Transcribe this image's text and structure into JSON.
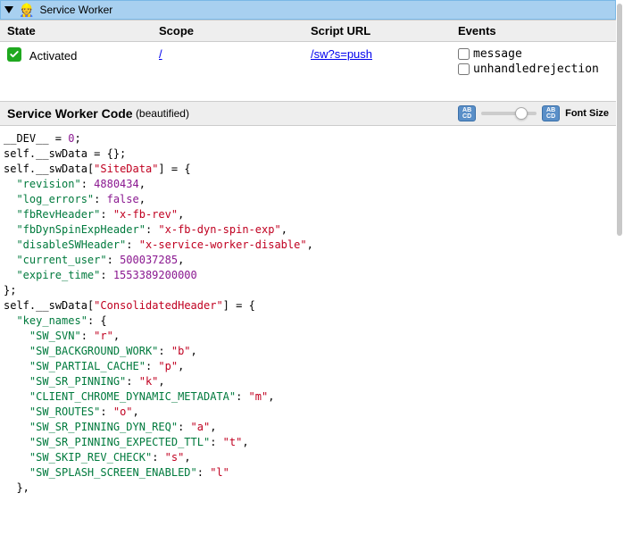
{
  "header": {
    "title": "Service Worker",
    "icon": "construction-worker"
  },
  "table": {
    "columns": [
      "State",
      "Scope",
      "Script URL",
      "Events"
    ],
    "state_label": "Activated",
    "scope_link": "/",
    "script_url_link": "/sw?s=push",
    "events": [
      {
        "name": "message",
        "checked": false
      },
      {
        "name": "unhandledrejection",
        "checked": false
      }
    ]
  },
  "codeHeader": {
    "title": "Service Worker Code",
    "sub": "(beautified)",
    "fontLabel": "Font Size"
  },
  "code": {
    "lines": [
      [
        [
          "ident",
          "__DEV__"
        ],
        [
          "punct",
          " = "
        ],
        [
          "num",
          "0"
        ],
        [
          "punct",
          ";"
        ]
      ],
      [
        [
          "ident",
          "self"
        ],
        [
          "punct",
          "."
        ],
        [
          "ident",
          "__swData"
        ],
        [
          "punct",
          " = {};"
        ]
      ],
      [
        [
          "ident",
          "self"
        ],
        [
          "punct",
          "."
        ],
        [
          "ident",
          "__swData"
        ],
        [
          "punct",
          "["
        ],
        [
          "str",
          "\"SiteData\""
        ],
        [
          "punct",
          "] = {"
        ]
      ],
      [
        [
          "pad",
          "  "
        ],
        [
          "prop",
          "\"revision\""
        ],
        [
          "punct",
          ": "
        ],
        [
          "num",
          "4880434"
        ],
        [
          "punct",
          ","
        ]
      ],
      [
        [
          "pad",
          "  "
        ],
        [
          "prop",
          "\"log_errors\""
        ],
        [
          "punct",
          ": "
        ],
        [
          "bool",
          "false"
        ],
        [
          "punct",
          ","
        ]
      ],
      [
        [
          "pad",
          "  "
        ],
        [
          "prop",
          "\"fbRevHeader\""
        ],
        [
          "punct",
          ": "
        ],
        [
          "str",
          "\"x-fb-rev\""
        ],
        [
          "punct",
          ","
        ]
      ],
      [
        [
          "pad",
          "  "
        ],
        [
          "prop",
          "\"fbDynSpinExpHeader\""
        ],
        [
          "punct",
          ": "
        ],
        [
          "str",
          "\"x-fb-dyn-spin-exp\""
        ],
        [
          "punct",
          ","
        ]
      ],
      [
        [
          "pad",
          "  "
        ],
        [
          "prop",
          "\"disableSWHeader\""
        ],
        [
          "punct",
          ": "
        ],
        [
          "str",
          "\"x-service-worker-disable\""
        ],
        [
          "punct",
          ","
        ]
      ],
      [
        [
          "pad",
          "  "
        ],
        [
          "prop",
          "\"current_user\""
        ],
        [
          "punct",
          ": "
        ],
        [
          "num",
          "500037285"
        ],
        [
          "punct",
          ","
        ]
      ],
      [
        [
          "pad",
          "  "
        ],
        [
          "prop",
          "\"expire_time\""
        ],
        [
          "punct",
          ": "
        ],
        [
          "num",
          "1553389200000"
        ]
      ],
      [
        [
          "punct",
          "};"
        ]
      ],
      [
        [
          "ident",
          "self"
        ],
        [
          "punct",
          "."
        ],
        [
          "ident",
          "__swData"
        ],
        [
          "punct",
          "["
        ],
        [
          "str",
          "\"ConsolidatedHeader\""
        ],
        [
          "punct",
          "] = {"
        ]
      ],
      [
        [
          "pad",
          "  "
        ],
        [
          "prop",
          "\"key_names\""
        ],
        [
          "punct",
          ": {"
        ]
      ],
      [
        [
          "pad",
          "    "
        ],
        [
          "prop",
          "\"SW_SVN\""
        ],
        [
          "punct",
          ": "
        ],
        [
          "str",
          "\"r\""
        ],
        [
          "punct",
          ","
        ]
      ],
      [
        [
          "pad",
          "    "
        ],
        [
          "prop",
          "\"SW_BACKGROUND_WORK\""
        ],
        [
          "punct",
          ": "
        ],
        [
          "str",
          "\"b\""
        ],
        [
          "punct",
          ","
        ]
      ],
      [
        [
          "pad",
          "    "
        ],
        [
          "prop",
          "\"SW_PARTIAL_CACHE\""
        ],
        [
          "punct",
          ": "
        ],
        [
          "str",
          "\"p\""
        ],
        [
          "punct",
          ","
        ]
      ],
      [
        [
          "pad",
          "    "
        ],
        [
          "prop",
          "\"SW_SR_PINNING\""
        ],
        [
          "punct",
          ": "
        ],
        [
          "str",
          "\"k\""
        ],
        [
          "punct",
          ","
        ]
      ],
      [
        [
          "pad",
          "    "
        ],
        [
          "prop",
          "\"CLIENT_CHROME_DYNAMIC_METADATA\""
        ],
        [
          "punct",
          ": "
        ],
        [
          "str",
          "\"m\""
        ],
        [
          "punct",
          ","
        ]
      ],
      [
        [
          "pad",
          "    "
        ],
        [
          "prop",
          "\"SW_ROUTES\""
        ],
        [
          "punct",
          ": "
        ],
        [
          "str",
          "\"o\""
        ],
        [
          "punct",
          ","
        ]
      ],
      [
        [
          "pad",
          "    "
        ],
        [
          "prop",
          "\"SW_SR_PINNING_DYN_REQ\""
        ],
        [
          "punct",
          ": "
        ],
        [
          "str",
          "\"a\""
        ],
        [
          "punct",
          ","
        ]
      ],
      [
        [
          "pad",
          "    "
        ],
        [
          "prop",
          "\"SW_SR_PINNING_EXPECTED_TTL\""
        ],
        [
          "punct",
          ": "
        ],
        [
          "str",
          "\"t\""
        ],
        [
          "punct",
          ","
        ]
      ],
      [
        [
          "pad",
          "    "
        ],
        [
          "prop",
          "\"SW_SKIP_REV_CHECK\""
        ],
        [
          "punct",
          ": "
        ],
        [
          "str",
          "\"s\""
        ],
        [
          "punct",
          ","
        ]
      ],
      [
        [
          "pad",
          "    "
        ],
        [
          "prop",
          "\"SW_SPLASH_SCREEN_ENABLED\""
        ],
        [
          "punct",
          ": "
        ],
        [
          "str",
          "\"l\""
        ]
      ],
      [
        [
          "pad",
          "  "
        ],
        [
          "punct",
          "},"
        ]
      ]
    ]
  }
}
